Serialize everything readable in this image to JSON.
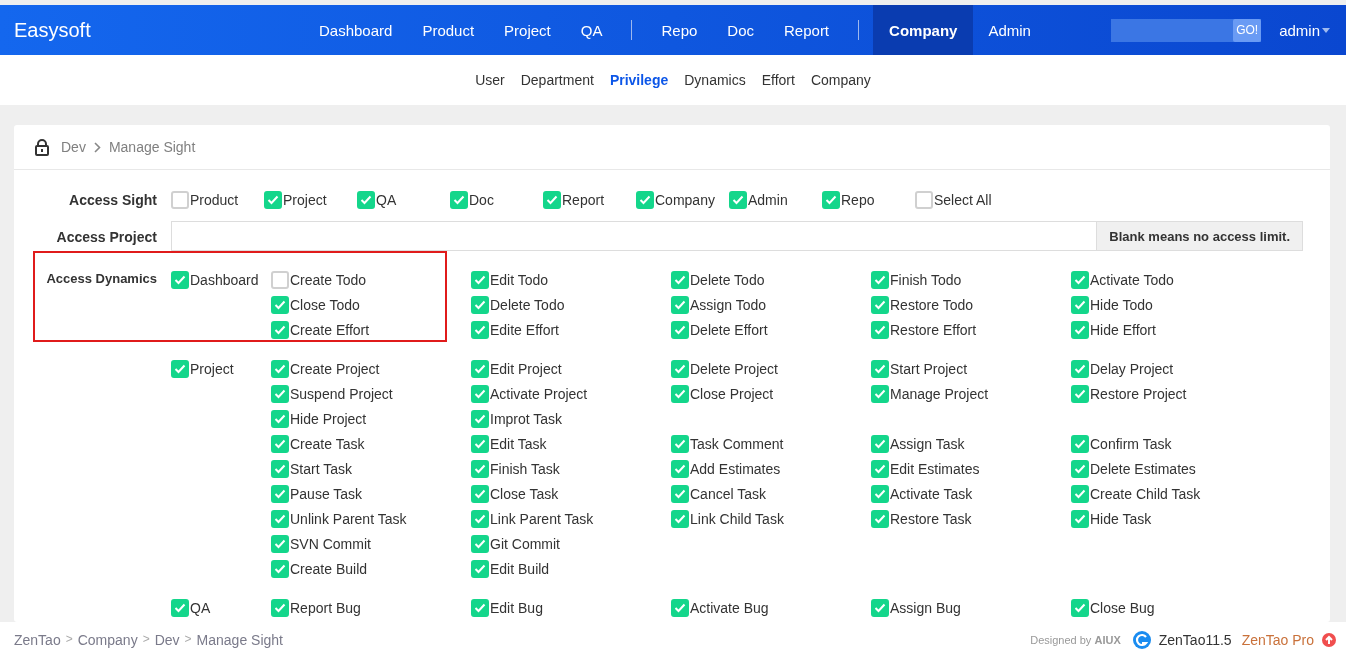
{
  "navbar": {
    "brand": "Easysoft",
    "groups": [
      [
        {
          "label": "Dashboard",
          "selected": false
        },
        {
          "label": "Product",
          "selected": false
        },
        {
          "label": "Project",
          "selected": false
        },
        {
          "label": "QA",
          "selected": false
        }
      ],
      [
        {
          "label": "Repo",
          "selected": false
        },
        {
          "label": "Doc",
          "selected": false
        },
        {
          "label": "Report",
          "selected": false
        }
      ],
      [
        {
          "label": "Company",
          "selected": true
        },
        {
          "label": "Admin",
          "selected": false
        }
      ]
    ],
    "search_button": "GO!",
    "user": "admin"
  },
  "subnav": [
    {
      "label": "User",
      "selected": false
    },
    {
      "label": "Department",
      "selected": false
    },
    {
      "label": "Privilege",
      "selected": true
    },
    {
      "label": "Dynamics",
      "selected": false
    },
    {
      "label": "Effort",
      "selected": false
    },
    {
      "label": "Company",
      "selected": false
    }
  ],
  "breadcrumb": [
    "Dev",
    "Manage Sight"
  ],
  "access_sight": {
    "label": "Access Sight",
    "options": [
      {
        "label": "Product",
        "checked": false
      },
      {
        "label": "Project",
        "checked": true
      },
      {
        "label": "QA",
        "checked": true
      },
      {
        "label": "Doc",
        "checked": true
      },
      {
        "label": "Report",
        "checked": true
      },
      {
        "label": "Company",
        "checked": true
      },
      {
        "label": "Admin",
        "checked": true
      },
      {
        "label": "Repo",
        "checked": true
      },
      {
        "label": "Select All",
        "checked": false
      }
    ]
  },
  "access_project": {
    "label": "Access Project",
    "addon": "Blank means no access limit."
  },
  "access_dynamics": {
    "label": "Access Dynamics",
    "groups": [
      {
        "label": "Dashboard",
        "checked": true,
        "highlighted": true,
        "rows": [
          [
            {
              "label": "Create Todo",
              "checked": false
            },
            {
              "label": "Edit Todo",
              "checked": true
            },
            {
              "label": "Delete Todo",
              "checked": true
            },
            {
              "label": "Finish Todo",
              "checked": true
            },
            {
              "label": "Activate Todo",
              "checked": true
            }
          ],
          [
            {
              "label": "Close Todo",
              "checked": true
            },
            {
              "label": "Delete Todo",
              "checked": true
            },
            {
              "label": "Assign Todo",
              "checked": true
            },
            {
              "label": "Restore Todo",
              "checked": true
            },
            {
              "label": "Hide Todo",
              "checked": true
            }
          ],
          [
            {
              "label": "Create Effort",
              "checked": true
            },
            {
              "label": "Edite Effort",
              "checked": true
            },
            {
              "label": "Delete Effort",
              "checked": true
            },
            {
              "label": "Restore Effort",
              "checked": true
            },
            {
              "label": "Hide Effort",
              "checked": true
            }
          ]
        ]
      },
      {
        "label": "Project",
        "checked": true,
        "highlighted": false,
        "rows": [
          [
            {
              "label": "Create Project",
              "checked": true
            },
            {
              "label": "Edit Project",
              "checked": true
            },
            {
              "label": "Delete Project",
              "checked": true
            },
            {
              "label": "Start Project",
              "checked": true
            },
            {
              "label": "Delay Project",
              "checked": true
            }
          ],
          [
            {
              "label": "Suspend Project",
              "checked": true
            },
            {
              "label": "Activate Project",
              "checked": true
            },
            {
              "label": "Close Project",
              "checked": true
            },
            {
              "label": "Manage Project",
              "checked": true
            },
            {
              "label": "Restore Project",
              "checked": true
            }
          ],
          [
            {
              "label": "Hide Project",
              "checked": true
            },
            {
              "label": "Improt Task",
              "checked": true
            }
          ],
          [
            {
              "label": "Create Task",
              "checked": true
            },
            {
              "label": "Edit Task",
              "checked": true
            },
            {
              "label": "Task Comment",
              "checked": true
            },
            {
              "label": "Assign Task",
              "checked": true
            },
            {
              "label": "Confirm Task",
              "checked": true
            }
          ],
          [
            {
              "label": "Start Task",
              "checked": true
            },
            {
              "label": "Finish Task",
              "checked": true
            },
            {
              "label": "Add Estimates",
              "checked": true
            },
            {
              "label": "Edit Estimates",
              "checked": true
            },
            {
              "label": "Delete Estimates",
              "checked": true
            }
          ],
          [
            {
              "label": "Pause Task",
              "checked": true
            },
            {
              "label": "Close Task",
              "checked": true
            },
            {
              "label": "Cancel Task",
              "checked": true
            },
            {
              "label": "Activate Task",
              "checked": true
            },
            {
              "label": "Create Child Task",
              "checked": true
            }
          ],
          [
            {
              "label": "Unlink Parent Task",
              "checked": true
            },
            {
              "label": "Link Parent Task",
              "checked": true
            },
            {
              "label": "Link Child Task",
              "checked": true
            },
            {
              "label": "Restore Task",
              "checked": true
            },
            {
              "label": "Hide Task",
              "checked": true
            }
          ],
          [
            {
              "label": "SVN Commit",
              "checked": true
            },
            {
              "label": "Git Commit",
              "checked": true
            }
          ],
          [
            {
              "label": "Create Build",
              "checked": true
            },
            {
              "label": "Edit Build",
              "checked": true
            }
          ]
        ]
      },
      {
        "label": "QA",
        "checked": true,
        "highlighted": false,
        "rows": [
          [
            {
              "label": "Report Bug",
              "checked": true
            },
            {
              "label": "Edit Bug",
              "checked": true
            },
            {
              "label": "Activate Bug",
              "checked": true
            },
            {
              "label": "Assign Bug",
              "checked": true
            },
            {
              "label": "Close Bug",
              "checked": true
            }
          ]
        ]
      }
    ]
  },
  "footer": {
    "breadcrumb": [
      "ZenTao",
      "Company",
      "Dev",
      "Manage Sight"
    ],
    "separator": ">",
    "designed_by": "Designed by **AIUX**",
    "version": "ZenTao11.5",
    "pro": "ZenTao Pro"
  }
}
